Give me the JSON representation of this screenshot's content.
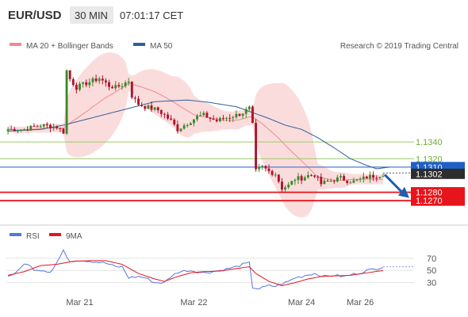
{
  "header": {
    "symbol": "EUR/USD",
    "interval": "30 MIN",
    "time": "07:01:17 CET"
  },
  "legend_top": [
    {
      "label": "MA 20 + Bollinger Bands",
      "color": "#f08a8a"
    },
    {
      "label": "MA 50",
      "color": "#2f5f9e"
    }
  ],
  "legend_bottom": [
    {
      "label": "RSI",
      "color": "#5577dd"
    },
    {
      "label": "9MA",
      "color": "#e8141b"
    }
  ],
  "credit": "Research © 2019 Trading Central",
  "colors": {
    "up": "#3a8a2a",
    "down": "#b2102b",
    "level_green": "#99cc66",
    "level_blue": "#4a7fcf",
    "level_red": "#e8141b",
    "band": "#f9c9c9"
  },
  "chart_data": [
    {
      "type": "candlestick",
      "y_range": [
        1.1256,
        1.1445
      ],
      "price_labels": [
        {
          "value": 1.134,
          "text": "1.1340",
          "style": "green"
        },
        {
          "value": 1.132,
          "text": "1.1320",
          "style": "green"
        },
        {
          "value": 1.131,
          "text": "1.1310",
          "style": "blue-box"
        },
        {
          "value": 1.1302,
          "text": "1.1302",
          "style": "dark-box"
        },
        {
          "value": 1.128,
          "text": "1.1280",
          "style": "red-box"
        },
        {
          "value": 1.127,
          "text": "1.1270",
          "style": "red-box"
        }
      ],
      "dotted_level": 1.1303,
      "forecast_arrow": {
        "from": 1.1303,
        "to": 1.1278
      },
      "x_labels": [
        {
          "text": "Mar 21",
          "index": 22
        },
        {
          "text": "Mar 22",
          "index": 57
        },
        {
          "text": "Mar 24",
          "index": 90
        },
        {
          "text": "Mar 26",
          "index": 108
        }
      ],
      "total_slots": 125,
      "price_anchors": [
        [
          0,
          1.1355
        ],
        [
          5,
          1.1355
        ],
        [
          10,
          1.136
        ],
        [
          15,
          1.1358
        ],
        [
          16,
          1.1355
        ],
        [
          17,
          1.1352
        ],
        [
          18,
          1.1425
        ],
        [
          19,
          1.1415
        ],
        [
          21,
          1.1405
        ],
        [
          24,
          1.141
        ],
        [
          26,
          1.1413
        ],
        [
          28,
          1.1416
        ],
        [
          31,
          1.1407
        ],
        [
          33,
          1.1405
        ],
        [
          35,
          1.1408
        ],
        [
          37,
          1.1413
        ],
        [
          38,
          1.1395
        ],
        [
          40,
          1.1385
        ],
        [
          42,
          1.1382
        ],
        [
          44,
          1.138
        ],
        [
          46,
          1.1378
        ],
        [
          48,
          1.1372
        ],
        [
          50,
          1.1365
        ],
        [
          52,
          1.1355
        ],
        [
          54,
          1.136
        ],
        [
          56,
          1.1365
        ],
        [
          58,
          1.137
        ],
        [
          60,
          1.1372
        ],
        [
          62,
          1.1368
        ],
        [
          64,
          1.1365
        ],
        [
          66,
          1.1368
        ],
        [
          68,
          1.137
        ],
        [
          70,
          1.1372
        ],
        [
          72,
          1.1375
        ],
        [
          74,
          1.138
        ],
        [
          75,
          1.136
        ],
        [
          76,
          1.1305
        ],
        [
          78,
          1.131
        ],
        [
          80,
          1.1305
        ],
        [
          82,
          1.1302
        ],
        [
          84,
          1.1285
        ],
        [
          86,
          1.1288
        ],
        [
          88,
          1.1296
        ],
        [
          90,
          1.1297
        ],
        [
          92,
          1.13
        ],
        [
          94,
          1.1301
        ],
        [
          96,
          1.129
        ],
        [
          98,
          1.1293
        ],
        [
          100,
          1.1295
        ],
        [
          102,
          1.1297
        ],
        [
          104,
          1.1294
        ],
        [
          106,
          1.1293
        ],
        [
          108,
          1.1295
        ],
        [
          110,
          1.1298
        ],
        [
          113,
          1.13
        ],
        [
          115,
          1.1302
        ]
      ],
      "ma50_anchors": [
        [
          0,
          1.1353
        ],
        [
          10,
          1.1355
        ],
        [
          17,
          1.136
        ],
        [
          25,
          1.1368
        ],
        [
          35,
          1.1378
        ],
        [
          45,
          1.1388
        ],
        [
          55,
          1.139
        ],
        [
          62,
          1.1387
        ],
        [
          70,
          1.1382
        ],
        [
          75,
          1.1375
        ],
        [
          80,
          1.1368
        ],
        [
          85,
          1.136
        ],
        [
          90,
          1.1355
        ],
        [
          95,
          1.1345
        ],
        [
          100,
          1.1333
        ],
        [
          105,
          1.132
        ],
        [
          110,
          1.1312
        ],
        [
          113,
          1.1308
        ],
        [
          117,
          1.131
        ]
      ],
      "rsi": {
        "ticks": [
          70,
          50,
          30
        ],
        "y_range": [
          10,
          88
        ],
        "rsi_anchors": [
          [
            0,
            40
          ],
          [
            3,
            48
          ],
          [
            5,
            62
          ],
          [
            7,
            56
          ],
          [
            8,
            52
          ],
          [
            11,
            50
          ],
          [
            13,
            48
          ],
          [
            14,
            54
          ],
          [
            17,
            82
          ],
          [
            19,
            65
          ],
          [
            21,
            67
          ],
          [
            24,
            66
          ],
          [
            27,
            64
          ],
          [
            30,
            62
          ],
          [
            33,
            56
          ],
          [
            35,
            56
          ],
          [
            37,
            38
          ],
          [
            40,
            40
          ],
          [
            42,
            38
          ],
          [
            45,
            30
          ],
          [
            48,
            30
          ],
          [
            50,
            40
          ],
          [
            52,
            47
          ],
          [
            55,
            50
          ],
          [
            57,
            49
          ],
          [
            60,
            46
          ],
          [
            65,
            50
          ],
          [
            70,
            56
          ],
          [
            72,
            60
          ],
          [
            74,
            62
          ],
          [
            75,
            22
          ],
          [
            77,
            20
          ],
          [
            80,
            25
          ],
          [
            82,
            24
          ],
          [
            84,
            28
          ],
          [
            86,
            32
          ],
          [
            88,
            38
          ],
          [
            90,
            40
          ],
          [
            92,
            43
          ],
          [
            94,
            45
          ],
          [
            97,
            40
          ],
          [
            100,
            42
          ],
          [
            103,
            40
          ],
          [
            106,
            44
          ],
          [
            108,
            46
          ],
          [
            110,
            50
          ],
          [
            113,
            53
          ],
          [
            115,
            56
          ]
        ],
        "ma_anchors": [
          [
            0,
            42
          ],
          [
            5,
            48
          ],
          [
            10,
            58
          ],
          [
            15,
            60
          ],
          [
            20,
            65
          ],
          [
            25,
            66
          ],
          [
            30,
            66
          ],
          [
            35,
            60
          ],
          [
            40,
            45
          ],
          [
            45,
            36
          ],
          [
            48,
            32
          ],
          [
            52,
            40
          ],
          [
            56,
            46
          ],
          [
            60,
            48
          ],
          [
            65,
            49
          ],
          [
            70,
            53
          ],
          [
            74,
            56
          ],
          [
            76,
            45
          ],
          [
            80,
            32
          ],
          [
            84,
            25
          ],
          [
            88,
            30
          ],
          [
            92,
            36
          ],
          [
            96,
            40
          ],
          [
            100,
            41
          ],
          [
            105,
            42
          ],
          [
            110,
            46
          ],
          [
            115,
            50
          ]
        ]
      }
    }
  ]
}
